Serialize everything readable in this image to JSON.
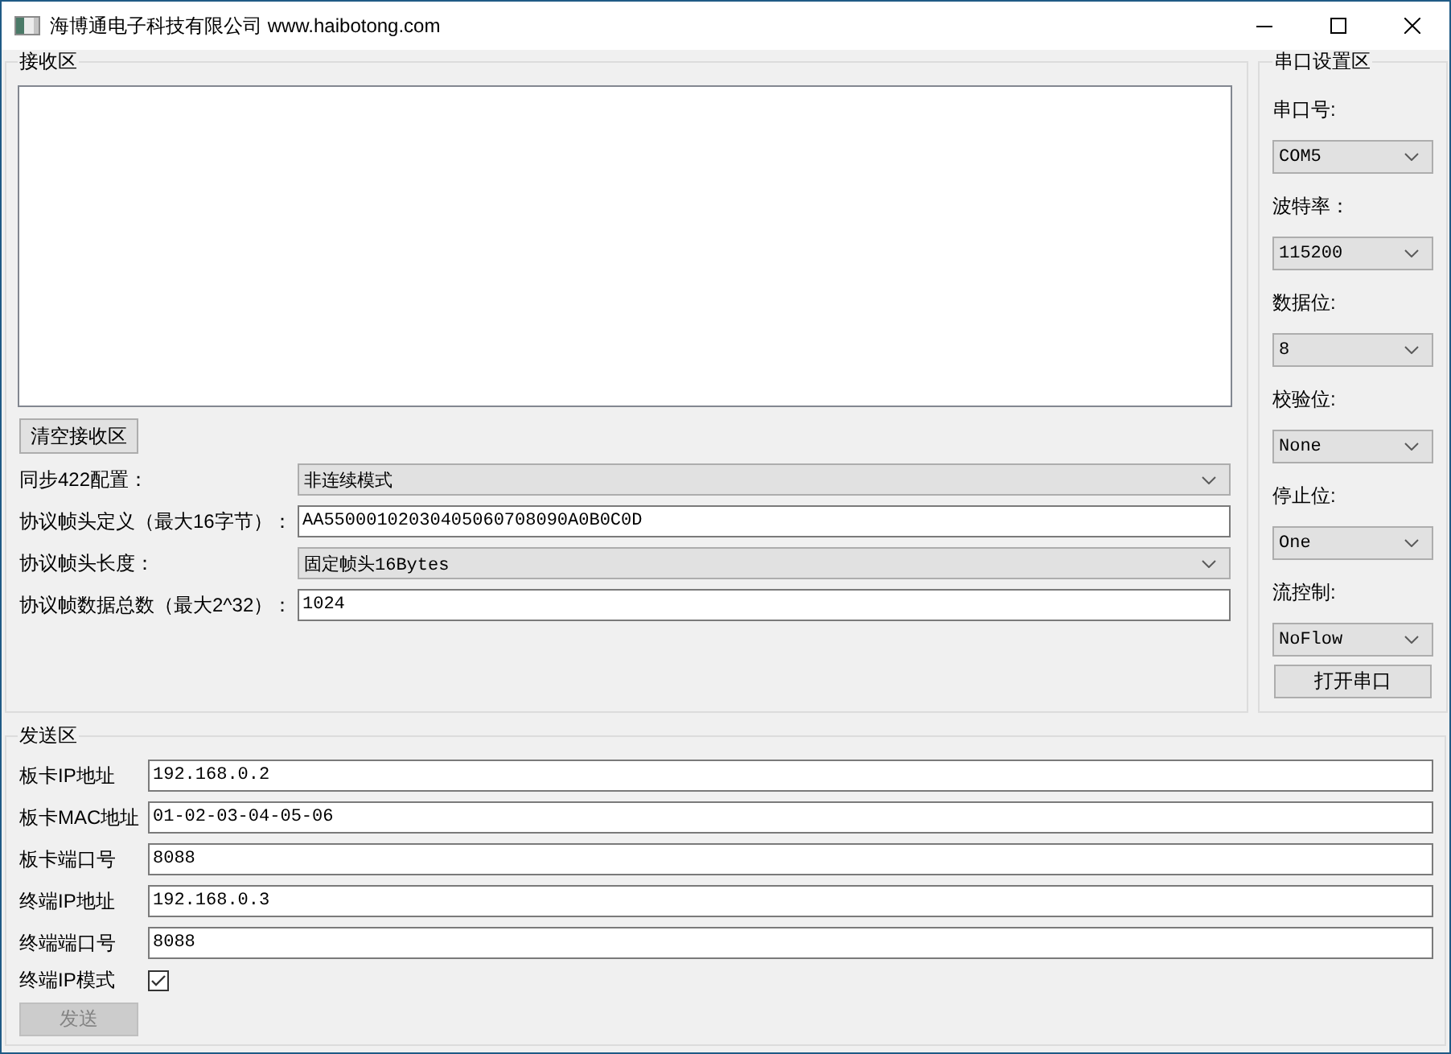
{
  "window": {
    "title": "海博通电子科技有限公司 www.haibotong.com"
  },
  "receive_group": {
    "title": "接收区",
    "clear_button": "清空接收区",
    "fields": [
      {
        "kind": "dropdown",
        "label": "同步422配置：",
        "value": "非连续模式"
      },
      {
        "kind": "input",
        "label": "协议帧头定义（最大16字节）：",
        "value": "AA55000102030405060708090A0B0C0D"
      },
      {
        "kind": "dropdown",
        "label": "协议帧头长度：",
        "value": "固定帧头16Bytes"
      },
      {
        "kind": "input",
        "label": "协议帧数据总数（最大2^32）：",
        "value": "1024"
      }
    ]
  },
  "serial_group": {
    "title": "串口设置区",
    "fields": [
      {
        "label": "串口号:",
        "value": "COM5"
      },
      {
        "label": "波特率：",
        "value": "115200"
      },
      {
        "label": "数据位:",
        "value": "8"
      },
      {
        "label": "校验位:",
        "value": "None"
      },
      {
        "label": "停止位:",
        "value": "One"
      },
      {
        "label": "流控制:",
        "value": "NoFlow"
      }
    ],
    "open_button": "打开串口"
  },
  "send_group": {
    "title": "发送区",
    "fields": [
      {
        "kind": "input",
        "label": "板卡IP地址",
        "value": "192.168.0.2"
      },
      {
        "kind": "input",
        "label": "板卡MAC地址",
        "value": "01-02-03-04-05-06"
      },
      {
        "kind": "input",
        "label": "板卡端口号",
        "value": "8088"
      },
      {
        "kind": "input",
        "label": "终端IP地址",
        "value": "192.168.0.3"
      },
      {
        "kind": "input",
        "label": "终端端口号",
        "value": "8088"
      },
      {
        "kind": "checkbox",
        "label": "终端IP模式",
        "checked": true
      }
    ],
    "send_button": {
      "label": "发送",
      "disabled": true
    }
  }
}
